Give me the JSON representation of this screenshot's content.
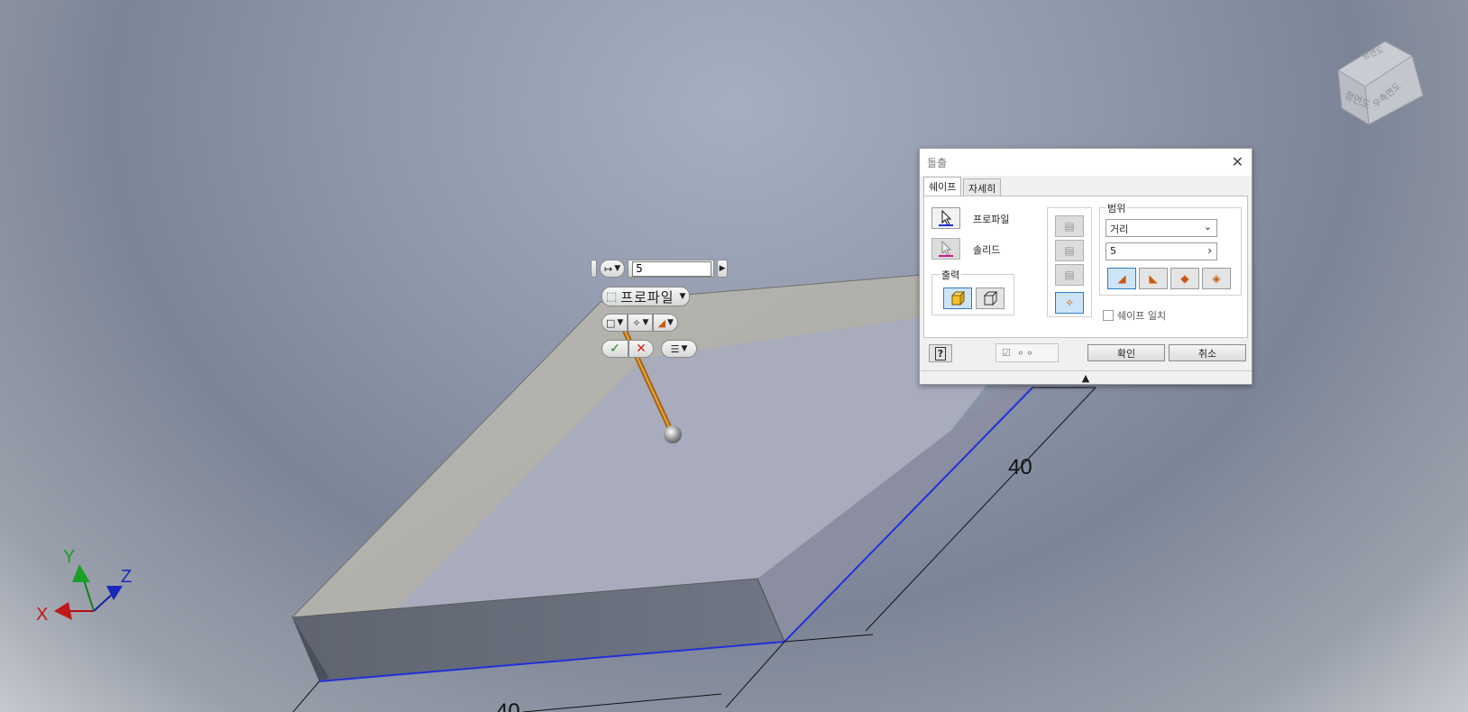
{
  "dialog": {
    "title": "돌출",
    "tabs": [
      {
        "label": "쉐이프"
      },
      {
        "label": "자세히"
      }
    ],
    "profile_label": "프로파일",
    "solid_label": "솔리드",
    "output_label": "출력",
    "extent_label": "범위",
    "extent_type": "거리",
    "distance_value": "5",
    "match_shape_label": "쉐이프 일치",
    "ok_label": "확인",
    "cancel_label": "취소"
  },
  "mini_toolbar": {
    "distance_value": "5",
    "profile_label": "프로파일"
  },
  "dimensions": {
    "right_edge": "40",
    "front_edge": "40"
  },
  "axes": {
    "x": "X",
    "y": "Y",
    "z": "Z"
  },
  "viewcube": {
    "top_label": "평면도",
    "front_label": "정면도",
    "right_label": "우측면도"
  },
  "colors": {
    "selection_edge": "#2030d8",
    "accent_blue": "#2f7ac3",
    "profile_highlight": "#cde4f7"
  }
}
